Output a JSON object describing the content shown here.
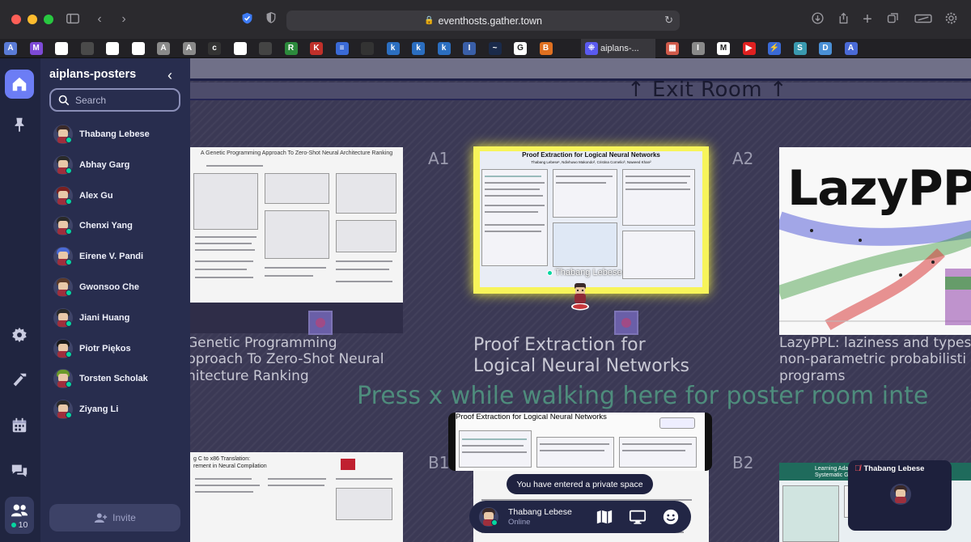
{
  "browser": {
    "url": "eventhosts.gather.town",
    "active_tab_label": "aiplans-...",
    "favicons": [
      {
        "name": "site-fav-1",
        "color": "#5a7bd6",
        "glyph": "A"
      },
      {
        "name": "site-fav-2",
        "color": "#7d4ad6",
        "glyph": "M"
      },
      {
        "name": "github-fav",
        "color": "#ffffff",
        "glyph": ""
      },
      {
        "name": "site-fav-4",
        "color": "#4a4a4a",
        "glyph": ""
      },
      {
        "name": "github-fav",
        "color": "#ffffff",
        "glyph": ""
      },
      {
        "name": "github-fav",
        "color": "#ffffff",
        "glyph": ""
      },
      {
        "name": "site-fav-7",
        "color": "#8a8a8a",
        "glyph": "A"
      },
      {
        "name": "site-fav-8",
        "color": "#8a8a8a",
        "glyph": "A"
      },
      {
        "name": "site-fav-9",
        "color": "#333333",
        "glyph": "c"
      },
      {
        "name": "github-fav",
        "color": "#ffffff",
        "glyph": ""
      },
      {
        "name": "site-fav-11",
        "color": "#444444",
        "glyph": ""
      },
      {
        "name": "site-fav-12",
        "color": "#2c8a3c",
        "glyph": "R"
      },
      {
        "name": "site-fav-13",
        "color": "#c0302a",
        "glyph": "K"
      },
      {
        "name": "site-fav-14",
        "color": "#3a6ad6",
        "glyph": "≡"
      },
      {
        "name": "site-fav-15",
        "color": "#333333",
        "glyph": ""
      },
      {
        "name": "site-fav-16",
        "color": "#2b6ec0",
        "glyph": "k"
      },
      {
        "name": "site-fav-17",
        "color": "#2b6ec0",
        "glyph": "k"
      },
      {
        "name": "site-fav-18",
        "color": "#2b6ec0",
        "glyph": "k"
      },
      {
        "name": "site-fav-19",
        "color": "#3a5fa8",
        "glyph": "I"
      },
      {
        "name": "site-fav-20",
        "color": "#1a2a4a",
        "glyph": "~"
      },
      {
        "name": "google-fav",
        "color": "#ffffff",
        "glyph": "G"
      },
      {
        "name": "site-fav-22",
        "color": "#e07020",
        "glyph": "B"
      }
    ],
    "favicons_right": [
      {
        "name": "site-fav-24",
        "color": "#d05a4a",
        "glyph": "▦"
      },
      {
        "name": "site-fav-25",
        "color": "#8a8a8a",
        "glyph": "I"
      },
      {
        "name": "gmail-fav",
        "color": "#ffffff",
        "glyph": "M"
      },
      {
        "name": "youtube-fav",
        "color": "#e02020",
        "glyph": "▶"
      },
      {
        "name": "site-fav-28",
        "color": "#3a6ad6",
        "glyph": "⚡"
      },
      {
        "name": "site-fav-29",
        "color": "#3a9ab0",
        "glyph": "S"
      },
      {
        "name": "site-fav-30",
        "color": "#4a90d6",
        "glyph": "D"
      },
      {
        "name": "site-fav-31",
        "color": "#4a6ad6",
        "glyph": "A"
      }
    ]
  },
  "panel": {
    "title": "aiplans-posters",
    "search_placeholder": "Search",
    "users": [
      {
        "name": "Thabang Lebese",
        "hair": "#3a2a2a"
      },
      {
        "name": "Abhay Garg",
        "hair": "#2a2a2a"
      },
      {
        "name": "Alex Gu",
        "hair": "#7a2020"
      },
      {
        "name": "Chenxi Yang",
        "hair": "#2a2a2a"
      },
      {
        "name": "Eirene V. Pandi",
        "hair": "#4a6ad6"
      },
      {
        "name": "Gwonsoo Che",
        "hair": "#5a3a2a"
      },
      {
        "name": "Jiani Huang",
        "hair": "#2a2a2a"
      },
      {
        "name": "Piotr Piękos",
        "hair": "#1a1a1a"
      },
      {
        "name": "Torsten Scholak",
        "hair": "#6a9a2a"
      },
      {
        "name": "Ziyang Li",
        "hair": "#2a2a2a"
      }
    ],
    "invite_label": "Invite"
  },
  "rail": {
    "online_count": "10"
  },
  "game": {
    "exit_room": "↑  Exit Room  ↑",
    "slot_a1": "A1",
    "slot_a2": "A2",
    "slot_b1": "B1",
    "slot_b2": "B2",
    "poster_left_header": "A Genetic Programming Approach To Zero-Shot Neural Architecture Ranking",
    "poster_left_title": "Genetic Programming\npproach To Zero-Shot Neural\nhitecture Ranking",
    "poster_center_header": "Proof Extraction for Logical Neural Networks",
    "poster_center_authors": "Thabang Lebese¹, Ndivhuwo Makondo², Cristina Cornelio³, Naweed Khan²",
    "poster_center_title": "Proof Extraction for\nLogical Neural Networks",
    "poster_right_header": "LazyPPL",
    "poster_right_title": "LazyPPL: laziness and types\nnon-parametric probabilisti\nprograms",
    "bottom_left_header": "g C to x86 Translation:\nrement in Neural Compilation",
    "bottom_right_header": "Learning Ada\nSystematic G",
    "press_hint": "Press x while walking here for poster room inte",
    "avatar_name": "Thabang Lebese",
    "preview_title": "Proof Extraction for Logical Neural Networks",
    "toast": "You have entered a private space",
    "me_name": "Thabang Lebese",
    "me_status": "Online",
    "video_name": "Thabang Lebese"
  }
}
